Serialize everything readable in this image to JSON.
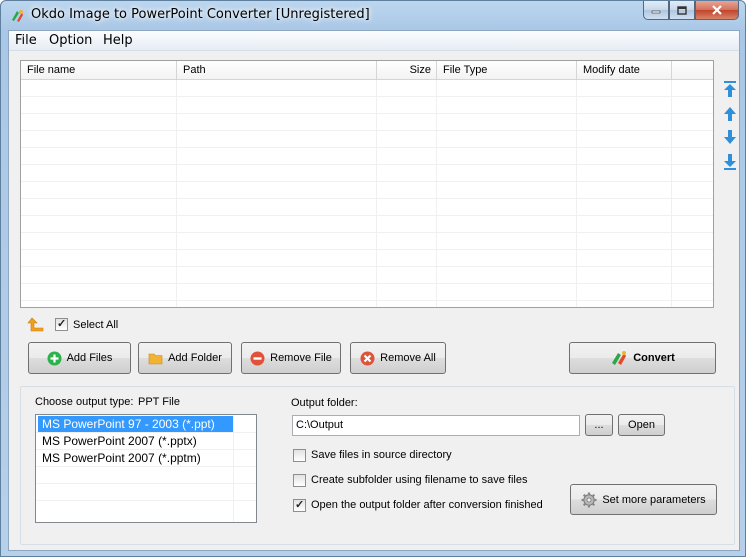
{
  "window": {
    "title": "Okdo Image to PowerPoint Converter [Unregistered]",
    "icon": "okdo-app-icon"
  },
  "menu": [
    "File",
    "Option",
    "Help"
  ],
  "file_list": {
    "columns": [
      "File name",
      "Path",
      "Size",
      "File Type",
      "Modify date"
    ],
    "rows": []
  },
  "side_controls": [
    "move-top-icon",
    "move-up-icon",
    "move-down-icon",
    "move-bottom-icon"
  ],
  "select_all": {
    "label": "Select All",
    "checked": true
  },
  "buttons": {
    "add_files": "Add Files",
    "add_folder": "Add Folder",
    "remove_file": "Remove File",
    "remove_all": "Remove All",
    "convert": "Convert"
  },
  "output": {
    "type_label": "Choose output type:",
    "type_value": "PPT File",
    "types": [
      {
        "label": "MS PowerPoint 97 - 2003 (*.ppt)",
        "selected": true
      },
      {
        "label": "MS PowerPoint 2007 (*.pptx)",
        "selected": false
      },
      {
        "label": "MS PowerPoint 2007 (*.pptm)",
        "selected": false
      }
    ],
    "folder_label": "Output folder:",
    "folder_value": "C:\\Output",
    "browse_label": "...",
    "open_label": "Open",
    "options": [
      {
        "label": "Save files in source directory",
        "checked": false
      },
      {
        "label": "Create subfolder using filename to save files",
        "checked": false
      },
      {
        "label": "Open the output folder after conversion finished",
        "checked": true
      }
    ],
    "more_params_label": "Set more parameters"
  },
  "colors": {
    "selection": "#3399ff",
    "title_close": "#c0442b",
    "arrow_blue": "#2f8fd8",
    "add_green": "#2bb24c",
    "remove_red": "#e0533b"
  }
}
